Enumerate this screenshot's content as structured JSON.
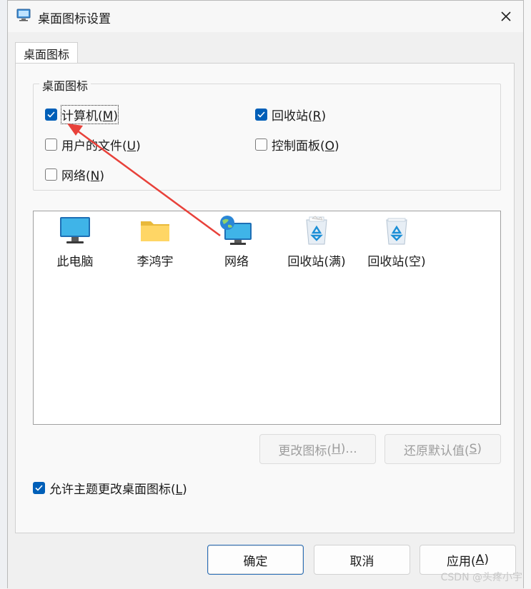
{
  "window": {
    "title": "桌面图标设置",
    "close_icon": "close-icon"
  },
  "tabs": [
    {
      "label": "桌面图标",
      "active": true
    }
  ],
  "group": {
    "legend": "桌面图标",
    "checkboxes": [
      {
        "label": "计算机(M)",
        "text": "计算机(",
        "key": "M",
        "tail": ")",
        "checked": true
      },
      {
        "label": "回收站(R)",
        "text": "回收站(",
        "key": "R",
        "tail": ")",
        "checked": true
      },
      {
        "label": "用户的文件(U)",
        "text": "用户的文件(",
        "key": "U",
        "tail": ")",
        "checked": false
      },
      {
        "label": "控制面板(O)",
        "text": "控制面板(",
        "key": "O",
        "tail": ")",
        "checked": false
      },
      {
        "label": "网络(N)",
        "text": "网络(",
        "key": "N",
        "tail": ")",
        "checked": false
      }
    ]
  },
  "icons": [
    {
      "label": "此电脑",
      "icon": "monitor-icon"
    },
    {
      "label": "李鸿宇",
      "icon": "folder-icon"
    },
    {
      "label": "网络",
      "icon": "network-globe-icon"
    },
    {
      "label": "回收站(满)",
      "icon": "recycle-bin-full-icon"
    },
    {
      "label": "回收站(空)",
      "icon": "recycle-bin-empty-icon"
    }
  ],
  "icon_buttons": {
    "change": {
      "text": "更改图标(",
      "key": "H",
      "tail": ")...",
      "enabled": false
    },
    "restore": {
      "text": "还原默认值(",
      "key": "S",
      "tail": ")",
      "enabled": false
    }
  },
  "allow_theme": {
    "text": "允许主题更改桌面图标(",
    "key": "L",
    "tail": ")",
    "checked": true
  },
  "footer": {
    "ok": "确定",
    "cancel": "取消",
    "apply_text": "应用(",
    "apply_key": "A",
    "apply_tail": ")"
  },
  "watermark": "CSDN @头疼小宇",
  "colors": {
    "accent": "#005fb8",
    "annotation_arrow": "#e8413a"
  }
}
